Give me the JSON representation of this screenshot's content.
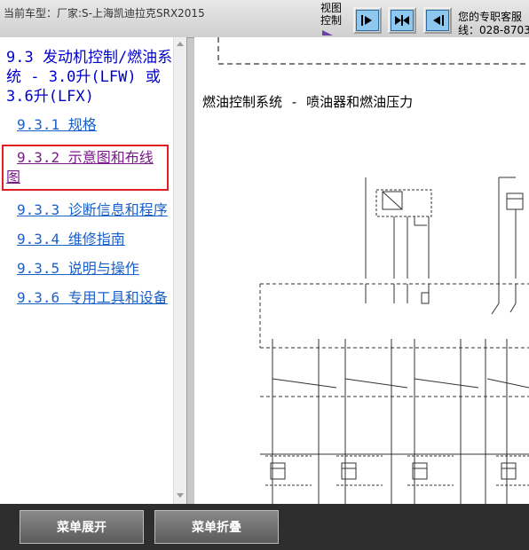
{
  "topbar": {
    "vehicle_label": "当前车型：厂家:S-上海凯迪拉克SRX2015",
    "view_control_label": "视图\n控制",
    "service_line1": "您的专职客服",
    "service_line2": "线：028-8703"
  },
  "left_panel": {
    "title": "9.3 发动机控制/燃油系统 - 3.0升(LFW) 或3.6升(LFX)",
    "items": [
      {
        "label": "9.3.1 规格"
      },
      {
        "label": "9.3.2 示意图和布线图",
        "selected": true
      },
      {
        "label": "9.3.3 诊断信息和程序"
      },
      {
        "label": "9.3.4 维修指南"
      },
      {
        "label": "9.3.5 说明与操作"
      },
      {
        "label": "9.3.6 专用工具和设备"
      }
    ]
  },
  "diagram": {
    "title": "燃油控制系统 - 喷油器和燃油压力"
  },
  "bottom_bar": {
    "expand_label": "菜单展开",
    "collapse_label": "菜单折叠"
  },
  "colors": {
    "link": "#1a5fc8",
    "title": "#0000cc",
    "selected_link": "#7a1a8a",
    "selected_border": "#e02020",
    "view_button": "#8ec8ee"
  }
}
